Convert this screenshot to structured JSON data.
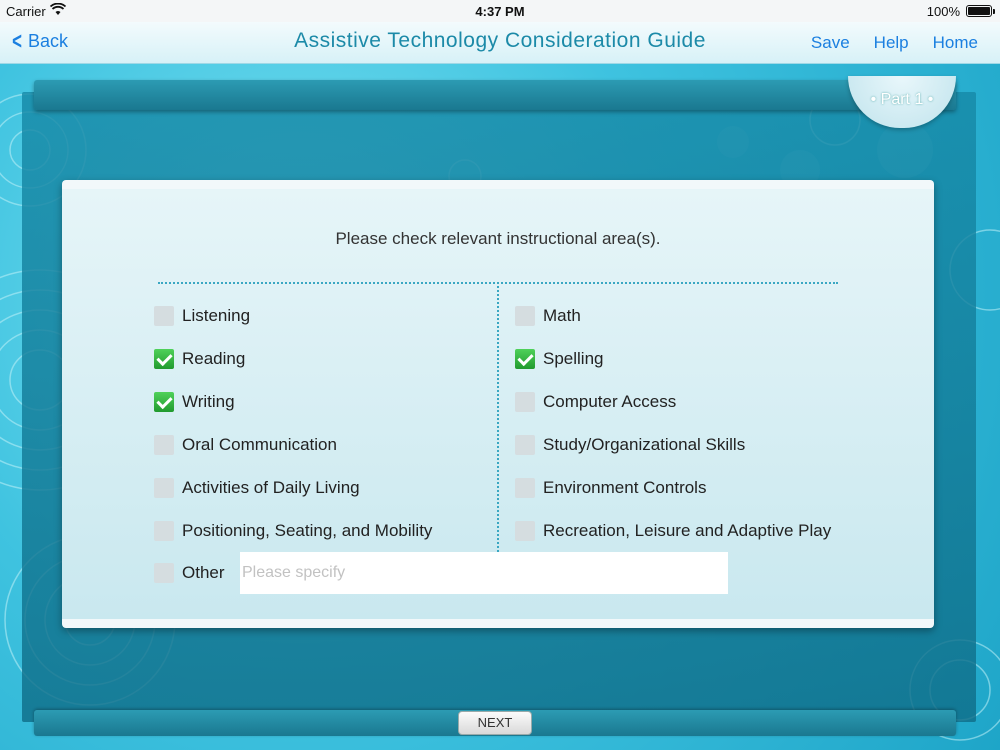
{
  "status_bar": {
    "carrier": "Carrier",
    "time": "4:37 PM",
    "battery": "100%"
  },
  "nav": {
    "back_label": "Back",
    "title": "Assistive Technology Consideration Guide",
    "save_label": "Save",
    "help_label": "Help",
    "home_label": "Home"
  },
  "part_tab": "• Part 1 •",
  "form": {
    "prompt": "Please check relevant instructional area(s).",
    "left_options": [
      {
        "label": "Listening",
        "checked": false
      },
      {
        "label": "Reading",
        "checked": true
      },
      {
        "label": "Writing",
        "checked": true
      },
      {
        "label": "Oral Communication",
        "checked": false
      },
      {
        "label": "Activities of Daily Living",
        "checked": false
      },
      {
        "label": "Positioning, Seating, and Mobility",
        "checked": false
      }
    ],
    "right_options": [
      {
        "label": "Math",
        "checked": false
      },
      {
        "label": "Spelling",
        "checked": true
      },
      {
        "label": "Computer Access",
        "checked": false
      },
      {
        "label": "Study/Organizational Skills",
        "checked": false
      },
      {
        "label": "Environment Controls",
        "checked": false
      },
      {
        "label": "Recreation, Leisure and Adaptive Play",
        "checked": false
      }
    ],
    "other": {
      "label": "Other",
      "checked": false,
      "value": "",
      "placeholder": "Please specify"
    }
  },
  "next_label": "NEXT",
  "colors": {
    "nav_link": "#1b7fe0",
    "title": "#1c8aa8",
    "panel": "#1a7890",
    "check_green": "#219a2e"
  }
}
